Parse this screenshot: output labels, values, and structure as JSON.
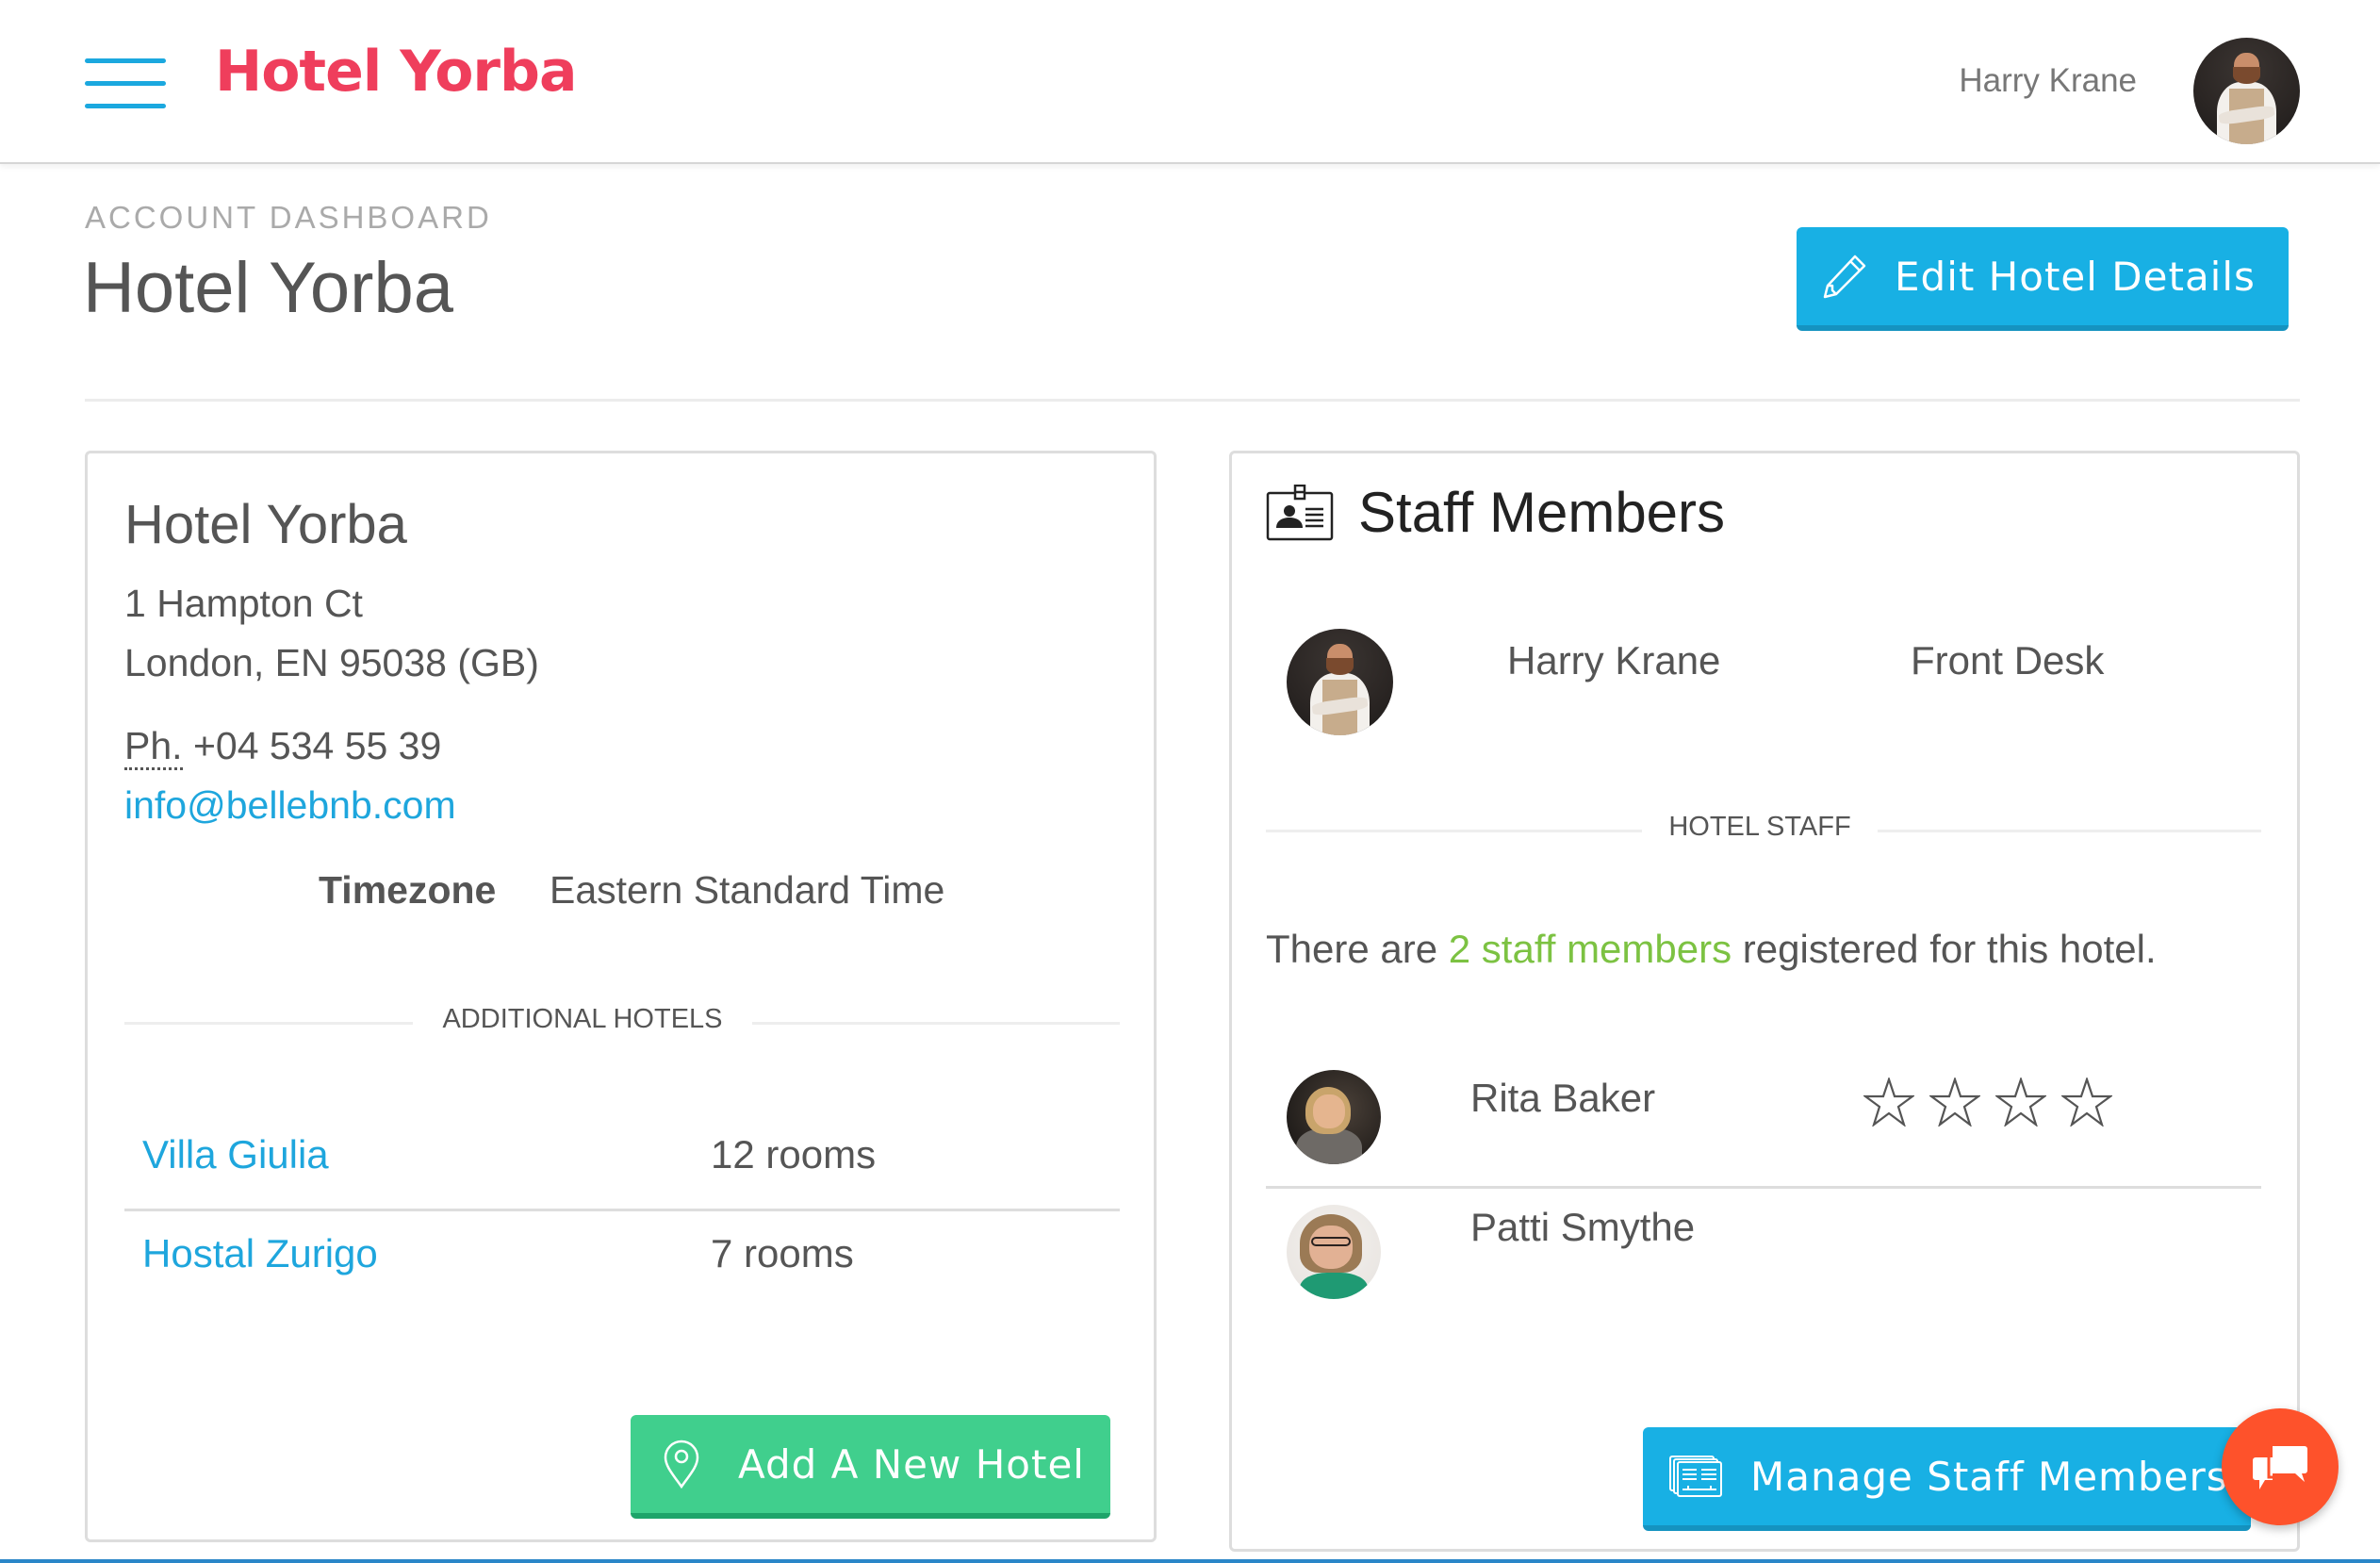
{
  "header": {
    "menu_icon": "hamburger-menu-icon",
    "logo_text": "Hotel Yorba",
    "user_name": "Harry Krane",
    "user_avatar": "user-avatar-harry",
    "colors": {
      "logo": "#ef3e5c",
      "menu": "#1ba8df"
    }
  },
  "page": {
    "eyebrow": "ACCOUNT DASHBOARD",
    "title": "Hotel Yorba",
    "edit_button": {
      "label": "Edit Hotel Details",
      "icon": "pencil-icon",
      "color": "#18b0e4"
    }
  },
  "hotel_card": {
    "name": "Hotel Yorba",
    "address_line1": "1 Hampton Ct",
    "address_line2": "London, EN 95038 (GB)",
    "phone_abbr": "Ph.",
    "phone_abbr_title": "Phone",
    "phone": "+04 534 55 39",
    "email": "info@bellebnb.com",
    "timezone_label": "Timezone",
    "timezone_value": "Eastern Standard Time",
    "additional_hotels_label": "ADDITIONAL HOTELS",
    "additional_hotels": [
      {
        "name": "Villa Giulia",
        "rooms": "12 rooms"
      },
      {
        "name": "Hostal Zurigo",
        "rooms": "7 rooms"
      }
    ],
    "add_button": {
      "label": "Add A New Hotel",
      "icon": "map-pin-icon",
      "color": "#40cf8d"
    }
  },
  "staff_card": {
    "title": "Staff Members",
    "title_icon": "id-badge-icon",
    "manager": {
      "name": "Harry Krane",
      "role": "Front Desk"
    },
    "hotel_staff_label": "HOTEL STAFF",
    "count_prefix": "There are ",
    "count_link": "2 staff members",
    "count_suffix": " registered for this hotel.",
    "staff": [
      {
        "name": "Rita Baker",
        "rating": 0,
        "rating_max": 4
      },
      {
        "name": "Patti Smythe"
      }
    ],
    "manage_button": {
      "label": "Manage Staff Members",
      "icon": "staff-list-icon",
      "color": "#18b0e4"
    }
  },
  "chat_button": {
    "icon": "chat-bubbles-icon",
    "color": "#fe522b"
  }
}
